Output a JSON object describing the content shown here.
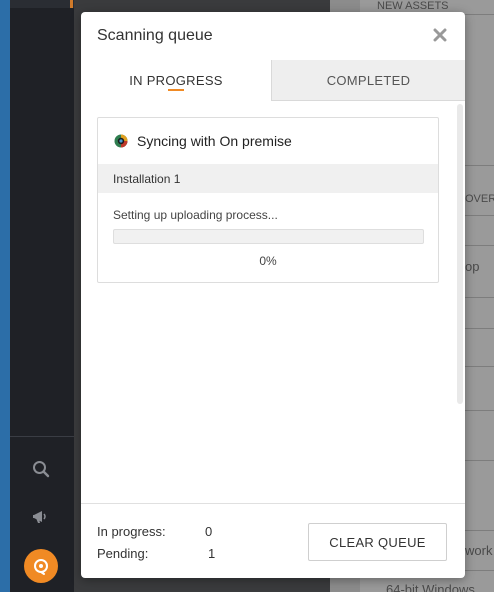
{
  "background": {
    "right_panel": {
      "header_label": "NEW ASSETS",
      "section_label": "OVERV",
      "row_fragment_1": "op",
      "row_fragment_2": "work",
      "row_fragment_3": "64-bit Windows"
    }
  },
  "sidebar": {
    "icons": [
      "search-icon",
      "megaphone-icon",
      "support-icon"
    ]
  },
  "modal": {
    "title": "Scanning queue",
    "close_icon": "close-icon",
    "tabs": [
      {
        "label": "IN PROGRESS",
        "active": true
      },
      {
        "label": "COMPLETED",
        "active": false
      }
    ],
    "job": {
      "title": "Syncing with On premise",
      "installation": "Installation 1",
      "status": "Setting up uploading process...",
      "progress_label": "0%",
      "progress_fraction": 0
    },
    "footer": {
      "in_progress_label": "In progress:",
      "in_progress_value": "0",
      "pending_label": "Pending:",
      "pending_value": "1",
      "clear_button": "CLEAR QUEUE"
    }
  },
  "colors": {
    "accent": "#f08a24",
    "sidebar": "#1f2126",
    "overlay": "#3a3b3d"
  }
}
